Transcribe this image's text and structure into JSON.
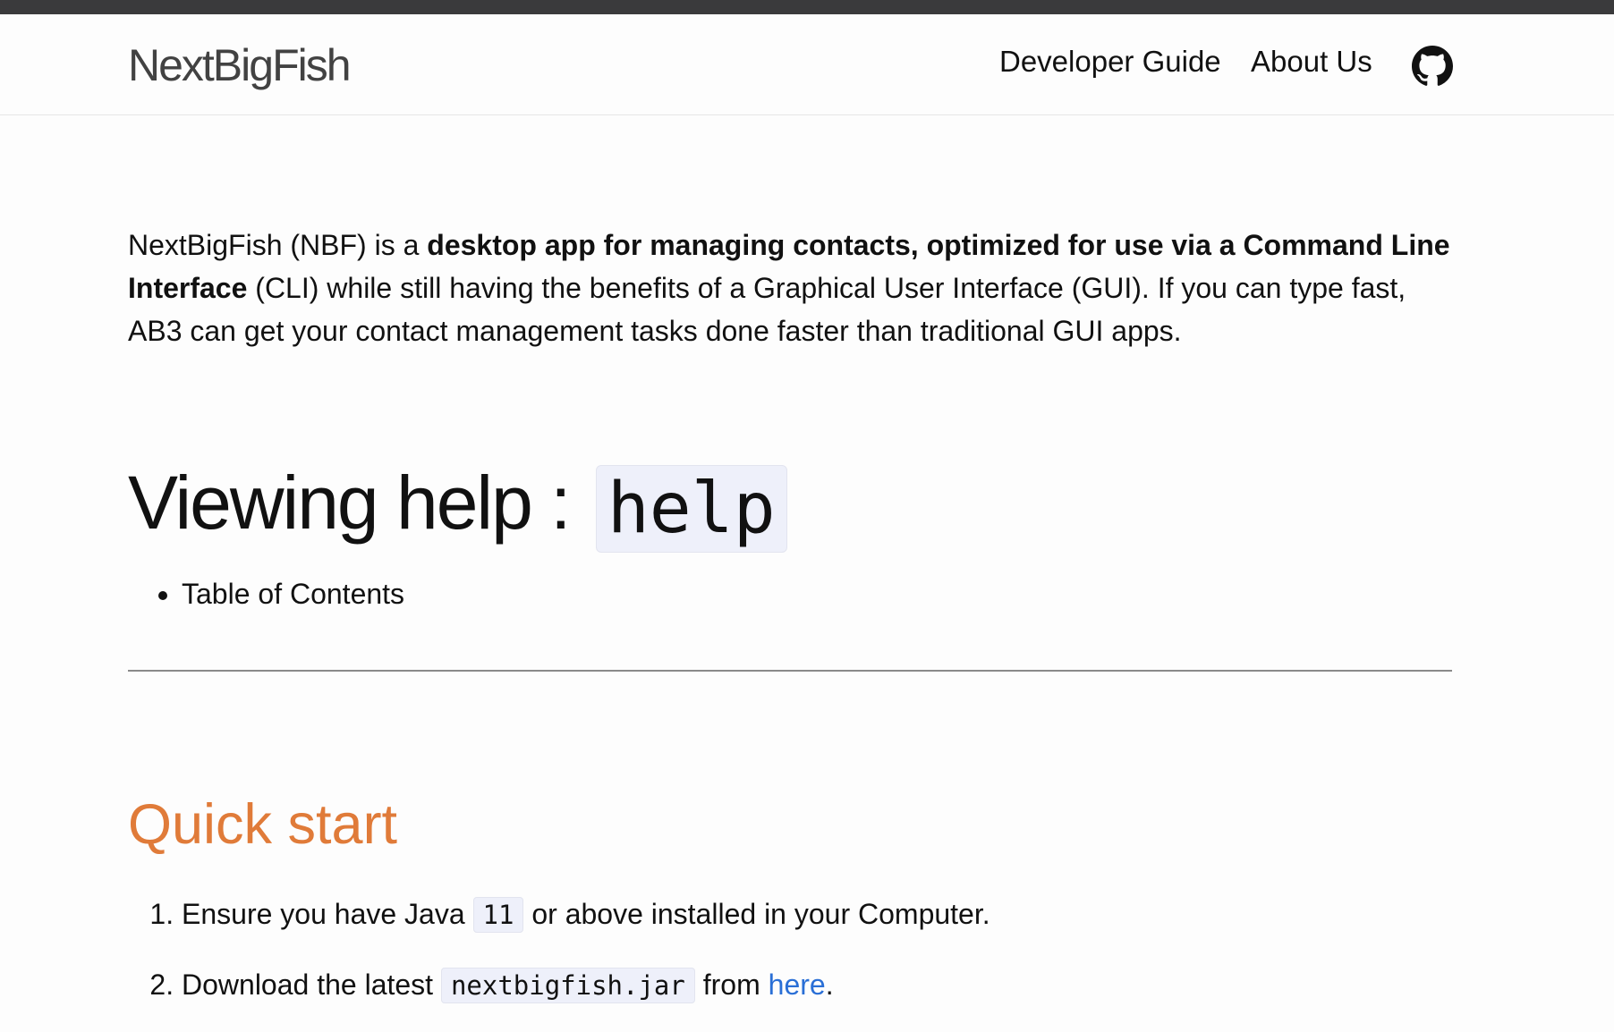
{
  "header": {
    "brand": "NextBigFish",
    "nav": [
      "Developer Guide",
      "About Us"
    ],
    "github_icon": "github-icon"
  },
  "intro": {
    "part1": "NextBigFish (NBF) is a ",
    "bold1": "desktop app for managing contacts, optimized for use via a Command Line Interface",
    "part2": " (CLI) while still having the benefits of a Graphical User Interface (GUI). If you can type fast, AB3 can get your contact management tasks done faster than traditional GUI apps."
  },
  "help_section": {
    "heading": "Viewing help : ",
    "code": "help",
    "toc_item": "Table of Contents"
  },
  "quick_start": {
    "heading": "Quick start",
    "step1": {
      "before": "Ensure you have Java ",
      "code": "11",
      "after": " or above installed in your Computer."
    },
    "step2": {
      "before": "Download the latest ",
      "code": "nextbigfish.jar",
      "middle": " from ",
      "link": "here",
      "after": "."
    }
  },
  "colors": {
    "accent_heading": "#e07b39",
    "link": "#2a6fd6",
    "code_bg": "#eef0fa"
  }
}
